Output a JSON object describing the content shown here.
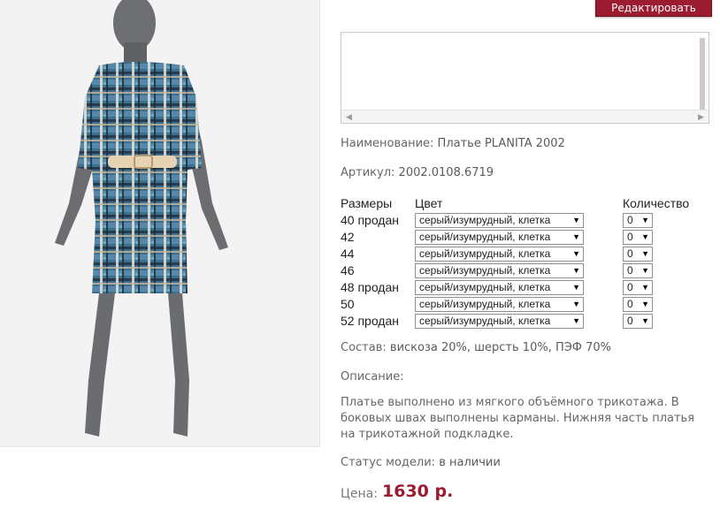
{
  "toolbar": {
    "edit_label": "Редактировать"
  },
  "product": {
    "name_label": "Наименование:",
    "name_value": "Платье PLANITA 2002",
    "article_label": "Артикул:",
    "article_value": "2002.0108.6719",
    "composition_label": "Состав:",
    "composition_value": "вискоза 20%, шерсть 10%, ПЭФ 70%",
    "description_label": "Описание:",
    "description_text": "Платье выполнено из мягкого объёмного трикотажа. В боковых швах выполнены карманы. Нижняя часть платья на трикотажной подкладке.",
    "status_label": "Статус модели:",
    "status_value": "в наличии",
    "price_label": "Цена:",
    "price_value": "1630 р."
  },
  "sizes_table": {
    "headers": {
      "size": "Размеры",
      "color": "Цвет",
      "qty": "Количество"
    },
    "rows": [
      {
        "size": "40 продан",
        "color": "серый/изумрудный, клетка",
        "qty": "0"
      },
      {
        "size": "42",
        "color": "серый/изумрудный, клетка",
        "qty": "0"
      },
      {
        "size": "44",
        "color": "серый/изумрудный, клетка",
        "qty": "0"
      },
      {
        "size": "46",
        "color": "серый/изумрудный, клетка",
        "qty": "0"
      },
      {
        "size": "48 продан",
        "color": "серый/изумрудный, клетка",
        "qty": "0"
      },
      {
        "size": "50",
        "color": "серый/изумрудный, клетка",
        "qty": "0"
      },
      {
        "size": "52 продан",
        "color": "серый/изумрудный, клетка",
        "qty": "0"
      }
    ]
  },
  "colors": {
    "accent": "#9b1b30",
    "text": "#5a5a5a"
  },
  "icons": {
    "dropdown": "chevron-down-icon"
  }
}
